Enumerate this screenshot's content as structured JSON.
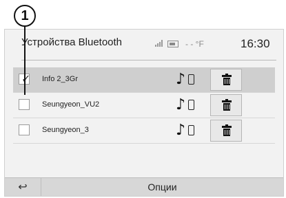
{
  "callout": {
    "number": "1"
  },
  "header": {
    "title": "Устройства Bluetooth",
    "temperature": "- - °F",
    "time": "16:30"
  },
  "devices": [
    {
      "name": "Info 2_3Gr",
      "checked": true
    },
    {
      "name": "Seungyeon_VU2",
      "checked": false
    },
    {
      "name": "Seungyeon_3",
      "checked": false
    }
  ],
  "icons": {
    "back": "back-arrow-icon",
    "music": "music-note-icon",
    "phone": "phone-icon",
    "trash": "trash-icon",
    "signal": "signal-icon",
    "battery": "battery-icon"
  },
  "footer": {
    "options_label": "Опции"
  }
}
